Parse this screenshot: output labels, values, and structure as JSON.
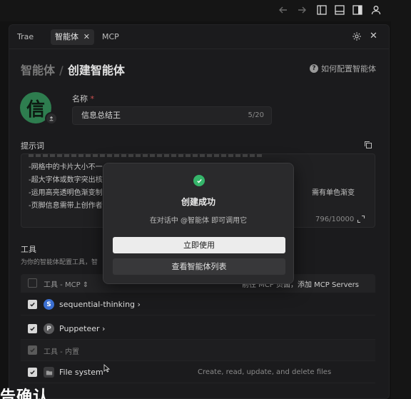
{
  "toolbar": {
    "icons": [
      "arrow-left-icon",
      "arrow-right-icon",
      "layout-left-icon",
      "layout-bottom-icon",
      "layout-right-icon",
      "account-icon"
    ]
  },
  "tabs": [
    {
      "label": "Trae",
      "active": false
    },
    {
      "label": "智能体",
      "active": true
    },
    {
      "label": "MCP",
      "active": false
    }
  ],
  "breadcrumb": {
    "parent": "智能体",
    "separator": "/",
    "current": "创建智能体"
  },
  "help_link": "如何配置智能体",
  "avatar_char": "信",
  "name_field": {
    "label": "名称",
    "required_mark": "*",
    "value": "信息总结王",
    "count": "5/20"
  },
  "prompt": {
    "label": "提示词",
    "lines": [
      "-网格中的卡片大小不一",
      "-超大字体或数字突出核",
      "-运用高亮透明色渐变制",
      "-页脚信息需带上创作者"
    ],
    "right_fragment": "需有单色渐变",
    "count": "796/10000"
  },
  "tools": {
    "title": "工具",
    "desc": "为你的智能体配置工具，智",
    "header_label": "工具 - MCP",
    "header_link": "前往 MCP 页面，添加 MCP Servers",
    "rows": [
      {
        "name": "sequential-thinking",
        "icon_letter": "S",
        "desc": ""
      },
      {
        "name": "Puppeteer",
        "icon_letter": "P",
        "desc": ""
      },
      {
        "name": "工具 - 内置",
        "icon_letter": "",
        "desc": ""
      },
      {
        "name": "File system",
        "icon_letter": "",
        "desc": "Create, read, update, and delete files"
      }
    ]
  },
  "bottom_text": "告确认",
  "modal": {
    "title": "创建成功",
    "subtitle": "在对话中 @智能体 即可调用它",
    "primary": "立即使用",
    "secondary": "查看智能体列表"
  },
  "colors": {
    "accent_green": "#35b56a",
    "avatar_green": "#2e7d4f",
    "blue_icon": "#3b6fd1"
  }
}
